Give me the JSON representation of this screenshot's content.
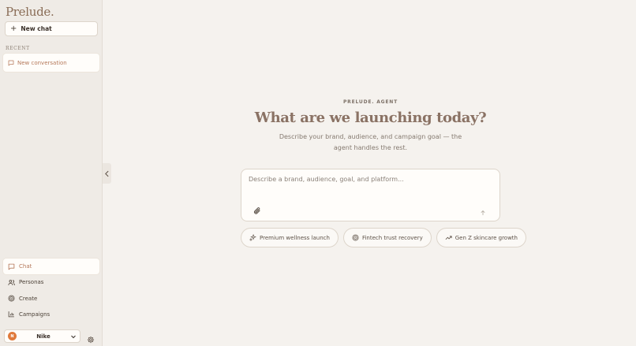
{
  "sidebar": {
    "brand": "Prelude.",
    "new_chat_label": "New chat",
    "recent_label": "RECENT",
    "recent_items": [
      {
        "label": "New conversation"
      }
    ],
    "nav": [
      {
        "label": "Chat",
        "icon": "chat-bubble-icon",
        "active": true
      },
      {
        "label": "Personas",
        "icon": "users-icon"
      },
      {
        "label": "Create",
        "icon": "target-icon"
      },
      {
        "label": "Campaigns",
        "icon": "bar-chart-icon"
      }
    ],
    "account": {
      "initial": "N",
      "name": "Nike"
    }
  },
  "main": {
    "eyebrow": "PRELUDE. AGENT",
    "headline": "What are we launching today?",
    "subtext": "Describe your brand, audience, and campaign goal — the agent handles the rest.",
    "composer": {
      "placeholder": "Describe a brand, audience, goal, and platform..."
    },
    "suggestions": [
      {
        "label": "Premium wellness launch",
        "icon": "sparkles-icon"
      },
      {
        "label": "Fintech trust recovery",
        "icon": "target-icon"
      },
      {
        "label": "Gen Z skincare growth",
        "icon": "trending-up-icon"
      }
    ]
  },
  "colors": {
    "accent": "#b5785a",
    "brand": "#8a6d57",
    "avatar": "#e07a3c"
  }
}
